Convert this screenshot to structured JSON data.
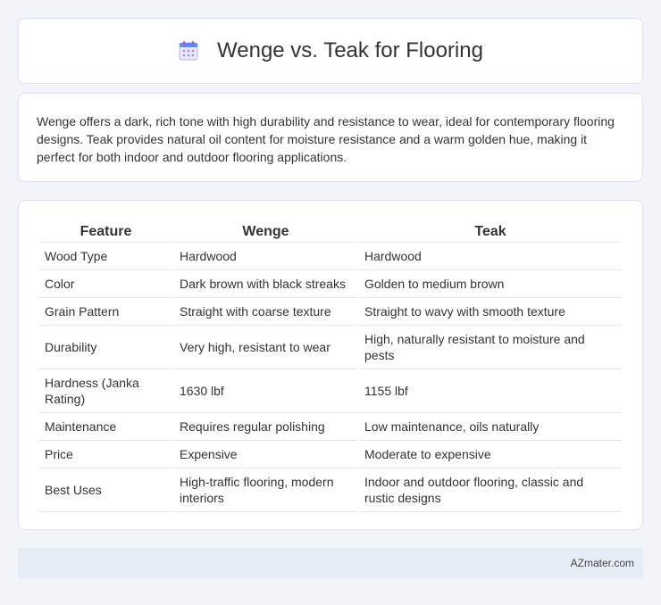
{
  "header": {
    "title": "Wenge vs. Teak for Flooring",
    "icon": "calendar-icon"
  },
  "intro": {
    "text": "Wenge offers a dark, rich tone with high durability and resistance to wear, ideal for contemporary flooring designs. Teak provides natural oil content for moisture resistance and a warm golden hue, making it perfect for both indoor and outdoor flooring applications."
  },
  "table": {
    "headers": [
      "Feature",
      "Wenge",
      "Teak"
    ],
    "rows": [
      [
        "Wood Type",
        "Hardwood",
        "Hardwood"
      ],
      [
        "Color",
        "Dark brown with black streaks",
        "Golden to medium brown"
      ],
      [
        "Grain Pattern",
        "Straight with coarse texture",
        "Straight to wavy with smooth texture"
      ],
      [
        "Durability",
        "Very high, resistant to wear",
        "High, naturally resistant to moisture and pests"
      ],
      [
        "Hardness (Janka Rating)",
        "1630 lbf",
        "1155 lbf"
      ],
      [
        "Maintenance",
        "Requires regular polishing",
        "Low maintenance, oils naturally"
      ],
      [
        "Price",
        "Expensive",
        "Moderate to expensive"
      ],
      [
        "Best Uses",
        "High-traffic flooring, modern interiors",
        "Indoor and outdoor flooring, classic and rustic designs"
      ]
    ]
  },
  "footer": {
    "text": "AZmater.com"
  }
}
